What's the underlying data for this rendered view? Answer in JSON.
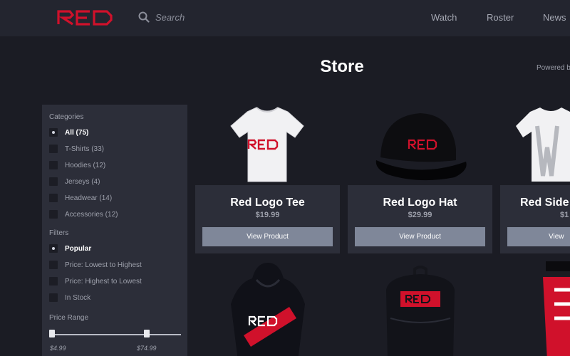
{
  "header": {
    "logo_text": "RED",
    "search_placeholder": "Search",
    "nav": [
      "Watch",
      "Roster",
      "News"
    ]
  },
  "page": {
    "title": "Store",
    "powered_by": "Powered b"
  },
  "sidebar": {
    "categories_label": "Categories",
    "categories": [
      {
        "label": "All (75)",
        "selected": true
      },
      {
        "label": "T-Shirts (33)",
        "selected": false
      },
      {
        "label": "Hoodies (12)",
        "selected": false
      },
      {
        "label": "Jerseys (4)",
        "selected": false
      },
      {
        "label": "Headwear (14)",
        "selected": false
      },
      {
        "label": "Accessories (12)",
        "selected": false
      }
    ],
    "filters_label": "Filters",
    "filters": [
      {
        "label": "Popular",
        "selected": true
      },
      {
        "label": "Price: Lowest to Highest",
        "selected": false
      },
      {
        "label": "Price: Highest to Lowest",
        "selected": false
      },
      {
        "label": "In Stock",
        "selected": false
      }
    ],
    "price_range_label": "Price Range",
    "price_min": "$4.99",
    "price_max": "$74.99"
  },
  "products": [
    {
      "name": "Red Logo Tee",
      "price": "$19.99",
      "button": "View Product"
    },
    {
      "name": "Red Logo Hat",
      "price": "$29.99",
      "button": "View Product"
    },
    {
      "name": "Red Side",
      "price": "$1",
      "button": "View"
    }
  ],
  "colors": {
    "brand_red": "#d0112b",
    "background": "#1b1c24",
    "panel": "#2c2e39",
    "button": "#7f8799"
  }
}
